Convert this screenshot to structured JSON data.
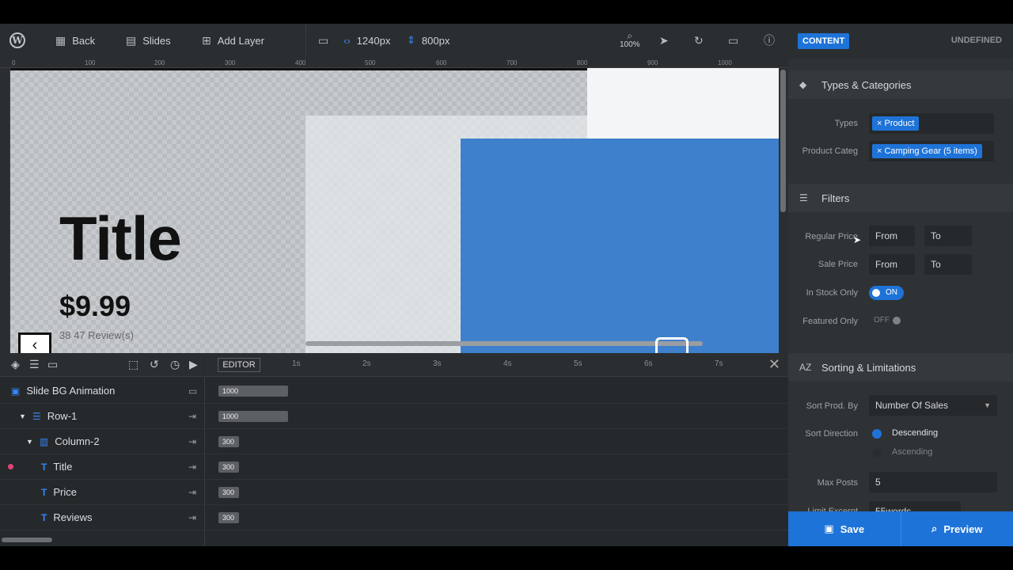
{
  "topbar": {
    "wp_logo": "W",
    "back_label": "Back",
    "slides_label": "Slides",
    "add_layer_label": "Add Layer",
    "width_value": "1240px",
    "height_value": "800px",
    "zoom_value": "100%"
  },
  "ruler": {
    "marks": [
      "0",
      "100",
      "200",
      "300",
      "400",
      "500",
      "600",
      "700",
      "800",
      "900",
      "1000"
    ]
  },
  "canvas": {
    "title": "Title",
    "price": "$9.99",
    "reviews": "38 47 Review(s)"
  },
  "timeline": {
    "editor_label": "EDITOR",
    "ticks": [
      "1s",
      "2s",
      "3s",
      "4s",
      "5s",
      "6s",
      "7s"
    ],
    "rows": [
      {
        "name": "Slide BG Animation",
        "duration": "1000"
      },
      {
        "name": "Row-1",
        "duration": "1000"
      },
      {
        "name": "Column-2",
        "duration": "300"
      },
      {
        "name": "Title",
        "duration": "300"
      },
      {
        "name": "Price",
        "duration": "300"
      },
      {
        "name": "Reviews",
        "duration": "300"
      }
    ]
  },
  "sidebar": {
    "content_tab": "CONTENT",
    "undefined_label": "UNDEFINED",
    "types_section": "Types & Categories",
    "types_label": "Types",
    "types_tag": "× Product",
    "category_label": "Product Categ",
    "category_tag": "× Camping Gear (5 items)",
    "filters_section": "Filters",
    "regular_price_label": "Regular Price",
    "sale_price_label": "Sale Price",
    "from_placeholder": "From",
    "to_placeholder": "To",
    "in_stock_label": "In Stock Only",
    "in_stock_value": "ON",
    "featured_label": "Featured Only",
    "featured_value": "OFF",
    "sorting_section": "Sorting & Limitations",
    "sort_by_label": "Sort Prod. By",
    "sort_by_value": "Number Of Sales",
    "sort_dir_label": "Sort Direction",
    "sort_desc": "Descending",
    "sort_asc": "Ascending",
    "max_posts_label": "Max Posts",
    "max_posts_value": "5",
    "limit_excerpt_label": "Limit Excerpt",
    "limit_excerpt_value": "55words",
    "save_label": "Save",
    "preview_label": "Preview"
  },
  "colors": {
    "accent": "#1e73d8",
    "canvas_blue": "#3e80cc"
  },
  "icons": [
    "wordpress-icon",
    "grid-icon",
    "slides-icon",
    "add-layer-icon",
    "monitor-icon",
    "search-icon",
    "cursor-icon",
    "undo-icon",
    "help-icon",
    "layers-icon",
    "menu-icon",
    "folder-icon",
    "play-icon",
    "tag-icon",
    "filter-icon",
    "sort-icon",
    "save-icon"
  ]
}
